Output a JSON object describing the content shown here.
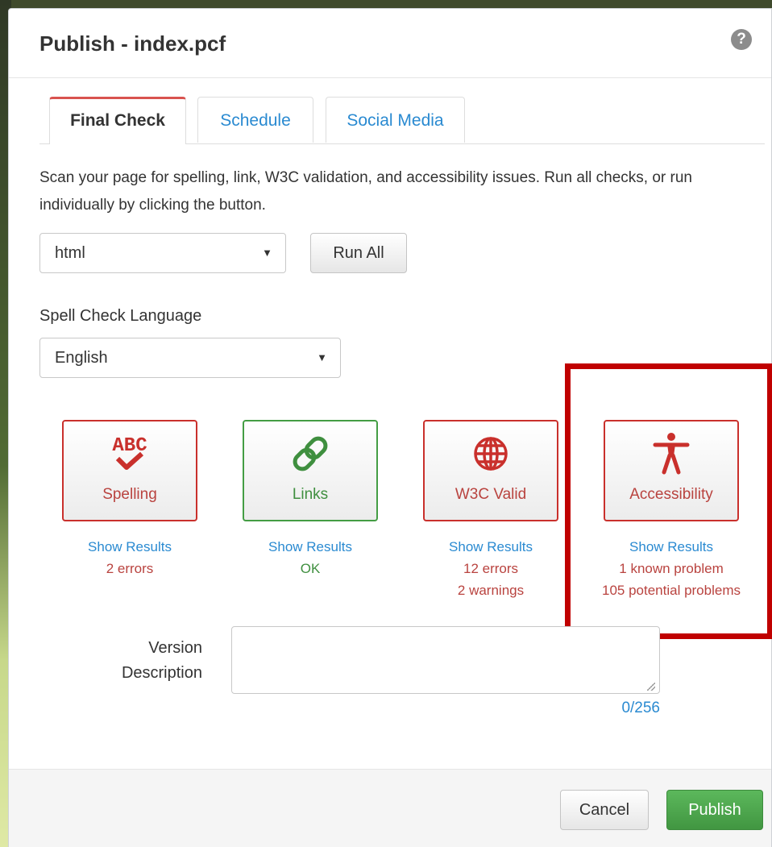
{
  "dialog": {
    "title": "Publish - index.pcf",
    "help_icon_glyph": "?"
  },
  "tabs": [
    {
      "label": "Final Check",
      "active": true
    },
    {
      "label": "Schedule",
      "active": false
    },
    {
      "label": "Social Media",
      "active": false
    }
  ],
  "final_check": {
    "intro": "Scan your page for spelling, link, W3C validation, and accessibility issues. Run all checks, or run individually by clicking the button.",
    "format_select": {
      "value": "html",
      "caret": "▼"
    },
    "run_all_label": "Run All",
    "spell_lang_label": "Spell Check Language",
    "spell_lang_select": {
      "value": "English",
      "caret": "▼"
    },
    "checks": [
      {
        "name": "Spelling",
        "icon": "spelling-abc-check-icon",
        "status": "error",
        "link": "Show Results",
        "lines": [
          "2 errors"
        ]
      },
      {
        "name": "Links",
        "icon": "link-chain-icon",
        "status": "ok",
        "link": "Show Results",
        "lines": [
          "OK"
        ]
      },
      {
        "name": "W3C Valid",
        "icon": "globe-icon",
        "status": "error",
        "link": "Show Results",
        "lines": [
          "12 errors",
          "2 warnings"
        ]
      },
      {
        "name": "Accessibility",
        "icon": "accessibility-person-icon",
        "status": "error",
        "link": "Show Results",
        "lines": [
          "1 known problem",
          "105 potential problems"
        ]
      }
    ],
    "highlight_color": "#c00000"
  },
  "version": {
    "label_line1": "Version",
    "label_line2": "Description",
    "value": "",
    "counter": "0/256"
  },
  "footer": {
    "cancel_label": "Cancel",
    "publish_label": "Publish"
  },
  "colors": {
    "link": "#2a8ad1",
    "error": "#b9433f",
    "ok": "#3f8f3f",
    "publish": "#5cb85c",
    "active_tab_accent": "#d9534f"
  }
}
